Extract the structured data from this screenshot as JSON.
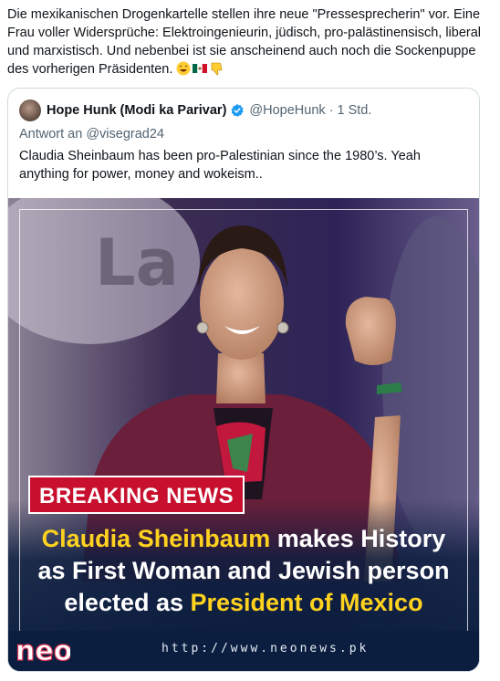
{
  "tweet": {
    "text": "Die mexikanischen Drogenkartelle stellen ihre neue \"Pressesprecherin\" vor. Eine Frau voller Widersprüche: Elektroingenieurin, jüdisch, pro-palästinensisch, liberal und marxistisch. Und nebenbei ist sie anscheinend auch noch die Sockenpuppe des vorherigen Präsidenten.",
    "emojis": [
      "laughing-face-emoji",
      "mexico-flag-emoji",
      "thumbs-down-emoji"
    ]
  },
  "quote": {
    "name": "Hope Hunk (Modi ka Parivar)",
    "handle": "@HopeHunk",
    "time": "· 1 Std.",
    "reply_to": "Antwort an @visegrad24",
    "text": "Claudia Sheinbaum has been pro-Palestinian since the 1980’s. Yeah anything for power, money and wokeism..",
    "icons": {
      "verified": "verified-badge-icon"
    }
  },
  "media": {
    "badge": "BREAKING NEWS",
    "headline": {
      "line1_highlight": "Claudia Sheinbaum",
      "line1_rest": " makes History",
      "line2": "as First Woman and Jewish person",
      "line3_plain": "elected as ",
      "line3_highlight": "President of Mexico"
    },
    "url": "http://www.neonews.pk",
    "logo": "neo",
    "colors": {
      "badge": "#c8102e",
      "highlight": "#ffd21f",
      "bar": "#0b1e3f"
    }
  }
}
